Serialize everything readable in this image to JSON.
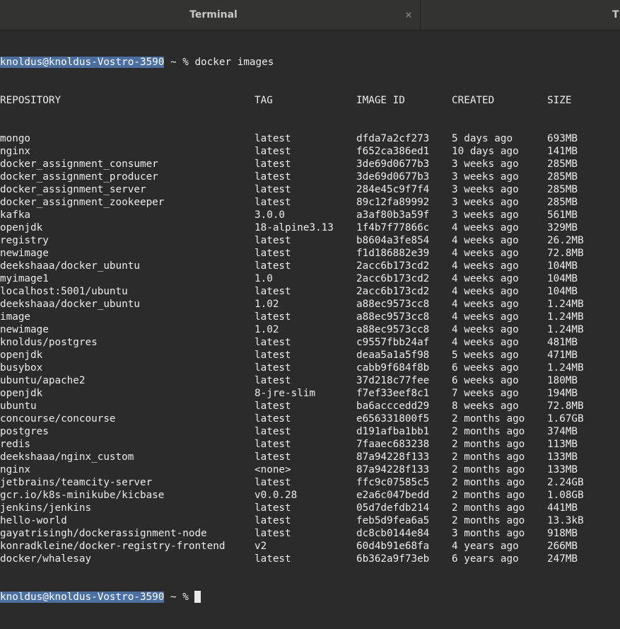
{
  "tabs": [
    {
      "label": "Terminal",
      "active": true,
      "close": "×"
    },
    {
      "label": "T",
      "active": false
    }
  ],
  "prompt": {
    "user_host": "knoldus@knoldus-Vostro-3590",
    "rest": " ~ % ",
    "command": "docker images"
  },
  "columns": [
    "REPOSITORY",
    "TAG",
    "IMAGE ID",
    "CREATED",
    "SIZE"
  ],
  "rows": [
    [
      "mongo",
      "latest",
      "dfda7a2cf273",
      "5 days ago",
      "693MB"
    ],
    [
      "nginx",
      "latest",
      "f652ca386ed1",
      "10 days ago",
      "141MB"
    ],
    [
      "docker_assignment_consumer",
      "latest",
      "3de69d0677b3",
      "3 weeks ago",
      "285MB"
    ],
    [
      "docker_assignment_producer",
      "latest",
      "3de69d0677b3",
      "3 weeks ago",
      "285MB"
    ],
    [
      "docker_assignment_server",
      "latest",
      "284e45c9f7f4",
      "3 weeks ago",
      "285MB"
    ],
    [
      "docker_assignment_zookeeper",
      "latest",
      "89c12fa89992",
      "3 weeks ago",
      "285MB"
    ],
    [
      "kafka",
      "3.0.0",
      "a3af80b3a59f",
      "3 weeks ago",
      "561MB"
    ],
    [
      "openjdk",
      "18-alpine3.13",
      "1f4b7f77866c",
      "4 weeks ago",
      "329MB"
    ],
    [
      "registry",
      "latest",
      "b8604a3fe854",
      "4 weeks ago",
      "26.2MB"
    ],
    [
      "newimage",
      "latest",
      "f1d186882e39",
      "4 weeks ago",
      "72.8MB"
    ],
    [
      "deekshaaa/docker_ubuntu",
      "latest",
      "2acc6b173cd2",
      "4 weeks ago",
      "104MB"
    ],
    [
      "myimage1",
      "1.0",
      "2acc6b173cd2",
      "4 weeks ago",
      "104MB"
    ],
    [
      "localhost:5001/ubuntu",
      "latest",
      "2acc6b173cd2",
      "4 weeks ago",
      "104MB"
    ],
    [
      "deekshaaa/docker_ubuntu",
      "1.02",
      "a88ec9573cc8",
      "4 weeks ago",
      "1.24MB"
    ],
    [
      "image",
      "latest",
      "a88ec9573cc8",
      "4 weeks ago",
      "1.24MB"
    ],
    [
      "newimage",
      "1.02",
      "a88ec9573cc8",
      "4 weeks ago",
      "1.24MB"
    ],
    [
      "knoldus/postgres",
      "latest",
      "c9557fbb24af",
      "4 weeks ago",
      "481MB"
    ],
    [
      "openjdk",
      "latest",
      "deaa5a1a5f98",
      "5 weeks ago",
      "471MB"
    ],
    [
      "busybox",
      "latest",
      "cabb9f684f8b",
      "6 weeks ago",
      "1.24MB"
    ],
    [
      "ubuntu/apache2",
      "latest",
      "37d218c77fee",
      "6 weeks ago",
      "180MB"
    ],
    [
      "openjdk",
      "8-jre-slim",
      "f7ef33eef8c1",
      "7 weeks ago",
      "194MB"
    ],
    [
      "ubuntu",
      "latest",
      "ba6acccedd29",
      "8 weeks ago",
      "72.8MB"
    ],
    [
      "concourse/concourse",
      "latest",
      "e656331800f5",
      "2 months ago",
      "1.67GB"
    ],
    [
      "postgres",
      "latest",
      "d191afba1bb1",
      "2 months ago",
      "374MB"
    ],
    [
      "redis",
      "latest",
      "7faaec683238",
      "2 months ago",
      "113MB"
    ],
    [
      "deekshaaa/nginx_custom",
      "latest",
      "87a94228f133",
      "2 months ago",
      "133MB"
    ],
    [
      "nginx",
      "<none>",
      "87a94228f133",
      "2 months ago",
      "133MB"
    ],
    [
      "jetbrains/teamcity-server",
      "latest",
      "ffc9c07585c5",
      "2 months ago",
      "2.24GB"
    ],
    [
      "gcr.io/k8s-minikube/kicbase",
      "v0.0.28",
      "e2a6c047bedd",
      "2 months ago",
      "1.08GB"
    ],
    [
      "jenkins/jenkins",
      "latest",
      "05d7defdb214",
      "2 months ago",
      "441MB"
    ],
    [
      "hello-world",
      "latest",
      "feb5d9fea6a5",
      "2 months ago",
      "13.3kB"
    ],
    [
      "gayatrisingh/dockerassignment-node",
      "latest",
      "dc8cb0144e84",
      "3 months ago",
      "918MB"
    ],
    [
      "konradkleine/docker-registry-frontend",
      "v2",
      "60d4b91e68fa",
      "4 years ago",
      "266MB"
    ],
    [
      "docker/whalesay",
      "latest",
      "6b362a9f73eb",
      "6 years ago",
      "247MB"
    ]
  ],
  "colors": {
    "background": "#2b2b2b",
    "text": "#ececec",
    "prompt_highlight": "#4a6fa0"
  }
}
